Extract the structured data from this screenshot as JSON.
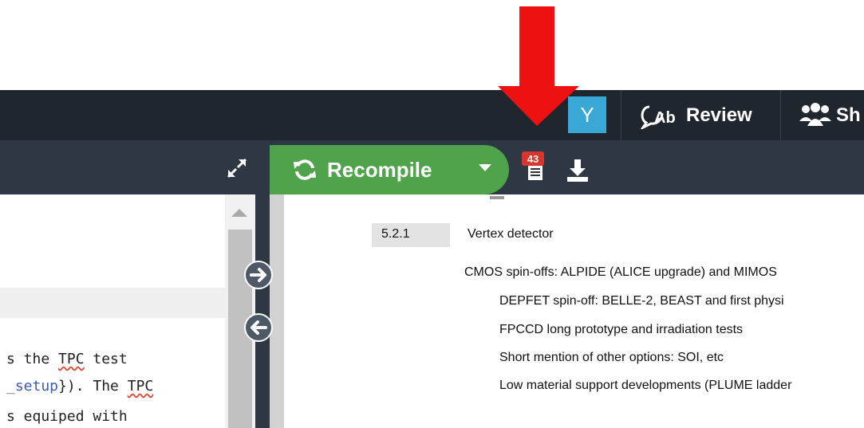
{
  "header": {
    "avatar_letter": "Y",
    "review_label": "Review",
    "share_label": "Sh"
  },
  "toolbar": {
    "recompile_label": "Recompile",
    "logs_badge_count": "43"
  },
  "editor": {
    "lines": [
      {
        "pre": "s the ",
        "warn": "TPC",
        "post": " test"
      },
      {
        "cite": "_setup",
        "mid": "}). The ",
        "warn": "TPC"
      },
      {
        "text": "s equiped with"
      }
    ]
  },
  "pdf": {
    "section_number": "5.2.1",
    "section_title": "Vertex detector",
    "items": [
      "CMOS spin-offs: ALPIDE (ALICE upgrade) and MIMOS",
      "DEPFET spin-off: BELLE-2, BEAST and first physi",
      "FPCCD long prototype and irradiation tests",
      "Short mention of other options: SOI, etc",
      "Low material support developments (PLUME ladder"
    ]
  },
  "colors": {
    "topbar": "#1f262d",
    "toolbar": "#2d3844",
    "recompile_green": "#4fa34b",
    "avatar_blue": "#3aa8d6",
    "badge_red": "#d9352f",
    "annotation_arrow": "#ee1111"
  },
  "icons": [
    "review-icon",
    "share-users-icon",
    "expand-icon",
    "refresh-icon",
    "caret-down-icon",
    "logs-icon",
    "download-icon",
    "arrow-right-icon",
    "arrow-left-icon"
  ]
}
